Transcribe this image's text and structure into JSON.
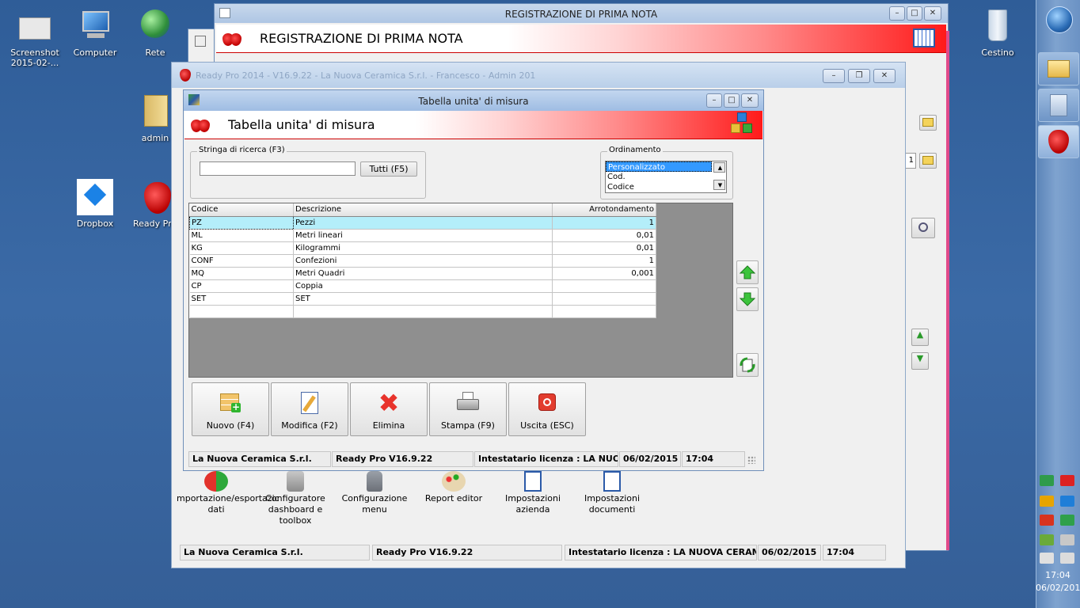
{
  "desktop": {
    "icons": [
      {
        "label": "Screenshot\n2015-02-...",
        "icon": "screenshot-file-icon"
      },
      {
        "label": "Computer",
        "icon": "computer-icon"
      },
      {
        "label": "Rete",
        "icon": "network-icon"
      },
      {
        "label": "admin",
        "icon": "user-folder-icon"
      },
      {
        "label": "Dropbox",
        "icon": "dropbox-icon"
      },
      {
        "label": "Ready Pr",
        "icon": "strawberry-icon"
      },
      {
        "label": "Cestino",
        "icon": "recycle-bin-icon"
      }
    ]
  },
  "taskbar": {
    "time": "17:04",
    "date": "06/02/201"
  },
  "window_prima_nota": {
    "title": "REGISTRAZIONE DI PRIMA NOTA",
    "banner_title": "REGISTRAZIONE DI PRIMA NOTA",
    "field_value": "1"
  },
  "window_main": {
    "title": "Ready Pro 2014 - V16.9.22 - La Nuova Ceramica S.r.l. - Francesco - Admin 201",
    "bottom_icons": [
      {
        "label": "mportazione/esportazic\ndati"
      },
      {
        "label": "Configuratore\ndashboard e\ntoolbox"
      },
      {
        "label": "Configurazione\nmenu"
      },
      {
        "label": "Report editor"
      },
      {
        "label": "Impostazioni\nazienda"
      },
      {
        "label": "Impostazioni\ndocumenti"
      }
    ],
    "status": {
      "company": "La Nuova Ceramica S.r.l.",
      "version": "Ready Pro V16.9.22",
      "license": "Intestatario licenza : LA NUOVA CERAMI(",
      "date": "06/02/2015",
      "time": "17:04"
    }
  },
  "dialog": {
    "title": "Tabella unita' di misura",
    "banner_title": "Tabella unita' di misura",
    "search": {
      "group_label": "Stringa di ricerca (F3)",
      "value": "",
      "all_button": "Tutti (F5)"
    },
    "sort": {
      "group_label": "Ordinamento",
      "options": [
        "Personalizzato",
        "Cod.",
        "Codice"
      ],
      "selected": "Personalizzato"
    },
    "table": {
      "columns": [
        "Codice",
        "Descrizione",
        "Arrotondamento"
      ],
      "rows": [
        {
          "code": "PZ",
          "desc": "Pezzi",
          "round": "1"
        },
        {
          "code": "ML",
          "desc": "Metri lineari",
          "round": "0,01"
        },
        {
          "code": "KG",
          "desc": "Kilogrammi",
          "round": "0,01"
        },
        {
          "code": "CONF",
          "desc": "Confezioni",
          "round": "1"
        },
        {
          "code": "MQ",
          "desc": "Metri Quadri",
          "round": "0,001"
        },
        {
          "code": "CP",
          "desc": "Coppia",
          "round": ""
        },
        {
          "code": "SET",
          "desc": "SET",
          "round": ""
        },
        {
          "code": "",
          "desc": "",
          "round": ""
        }
      ]
    },
    "toolbar": {
      "new": "Nuovo (F4)",
      "edit": "Modifica (F2)",
      "delete": "Elimina",
      "print": "Stampa (F9)",
      "exit": "Uscita (ESC)"
    },
    "status": {
      "company": "La Nuova Ceramica S.r.l.",
      "version": "Ready Pro V16.9.22",
      "license": "Intestatario licenza : LA NUOVA",
      "date": "06/02/2015",
      "time": "17:04"
    }
  },
  "colors": {
    "selected_row": "#b4eefa",
    "banner_red": "#ff1a1a",
    "desktop": "#3b68a3"
  }
}
